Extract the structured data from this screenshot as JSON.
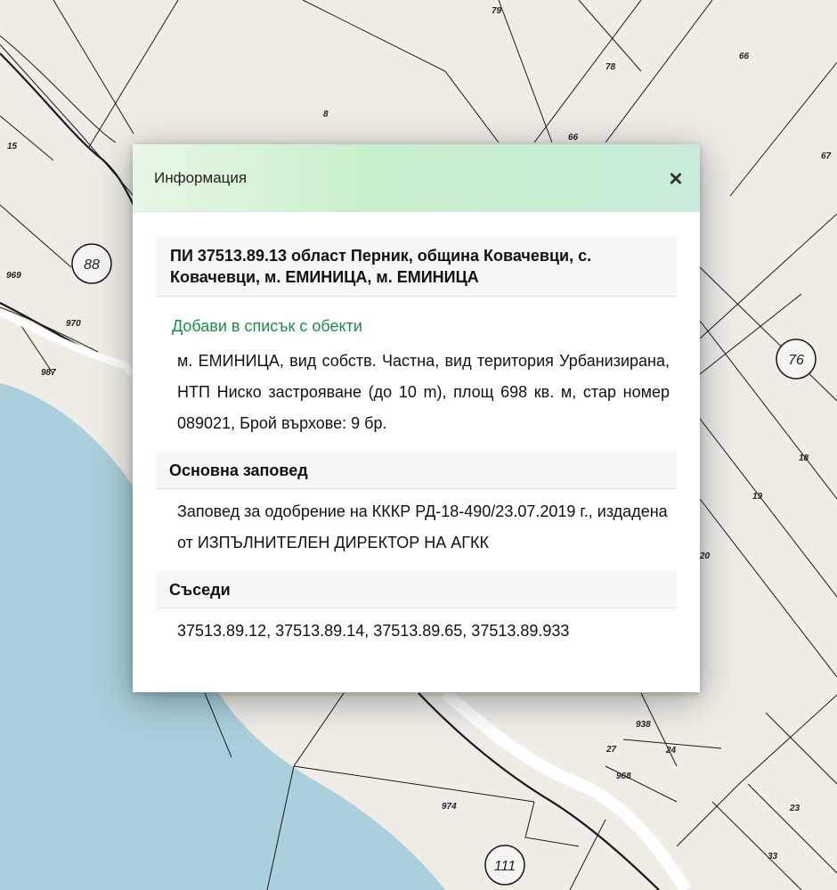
{
  "map": {
    "parcel_labels": [
      "79",
      "78",
      "66",
      "66",
      "67",
      "8",
      "15",
      "969",
      "970",
      "987",
      "18",
      "19",
      "20",
      "938",
      "27",
      "24",
      "968",
      "974",
      "23",
      "33"
    ],
    "circle_labels": [
      "88",
      "76",
      "111"
    ],
    "colors": {
      "land": "#efede6",
      "water": "#a9d0dc",
      "line": "#1a1a1a"
    }
  },
  "modal": {
    "title": "Информация",
    "close_icon": "close-icon",
    "heading": "ПИ 37513.89.13 област Перник, община Ковачевци, с. Ковачевци, м. ЕМИНИЦА, м. ЕМИНИЦА",
    "add_link": "Добави в списък с обекти",
    "details": "м. ЕМИНИЦА, вид собств. Частна, вид територия Урбанизирана, НТП Ниско застрояване (до 10 m), площ 698 кв. м, стар номер 089021, Брой върхове: 9 бр.",
    "order_title": "Основна заповед",
    "order_text": "Заповед за одобрение на КККР РД-18-490/23.07.2019 г., издадена от ИЗПЪЛНИТЕЛЕН ДИРЕКТОР НА АГКК",
    "neighbours_title": "Съседи",
    "neighbours_text": "37513.89.12, 37513.89.14, 37513.89.65, 37513.89.933",
    "accent_color": "#1e8a4e"
  }
}
